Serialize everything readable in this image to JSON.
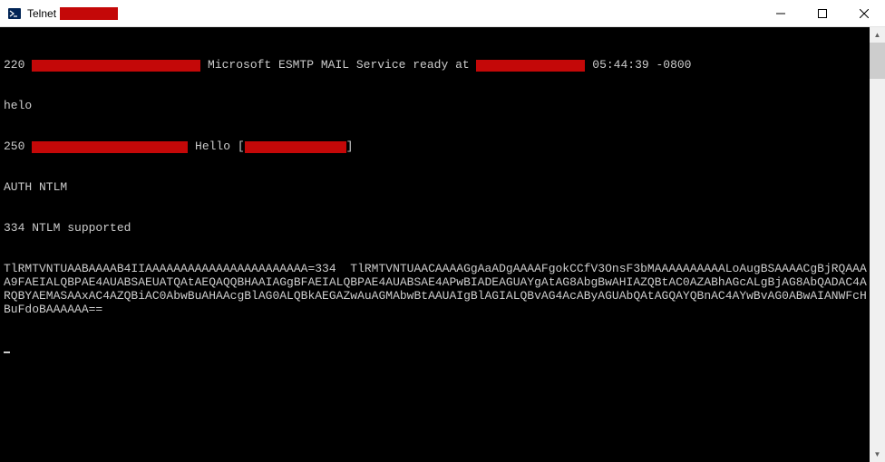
{
  "window": {
    "app_prefix": "Telnet ",
    "title_redact_width": 64
  },
  "terminal": {
    "line1_prefix": "220 ",
    "line1_redact_width": 186,
    "line1_mid": " Microsoft ESMTP MAIL Service ready at ",
    "line1_redact2_width": 120,
    "line1_time": " 05:44:39 -0800",
    "line2": "helo",
    "line3_prefix": "250 ",
    "line3_redact_width": 172,
    "line3_mid": " Hello [",
    "line3_redact2_width": 112,
    "line3_suffix": "]",
    "line4": "AUTH NTLM",
    "line5": "334 NTLM supported",
    "blob": "TlRMTVNTUAABAAAAB4IIAAAAAAAAAAAAAAAAAAAAAAA=334  TlRMTVNTUAACAAAAGgAaADgAAAAFgokCCfV3OnsF3bMAAAAAAAAAALoAugBSAAAACgBjRQAAAA9FAEIALQBPAE4AUABSAEUATQAtAEQAQQBHAAIAGgBFAEIALQBPAE4AUABSAE4APwBIADEAGUAYgAtAG8AbgBwAHIAZQBtAC0AZABhAGcALgBjAG8AbQADAC4ARQBYAEMASAAxAC4AZQBiAC0AbwBuAHAAcgBlAG0ALQBkAEGAZwAuAGMAbwBtAAUAIgBlAGIALQBvAG4AcAByAGUAbQAtAGQAYQBnAC4AYwBvAG0ABwAIANWFcHBuFdoBAAAAAA=="
  },
  "icons": {
    "app": "powershell-icon",
    "min": "minimize-icon",
    "max": "maximize-icon",
    "close": "close-icon"
  }
}
